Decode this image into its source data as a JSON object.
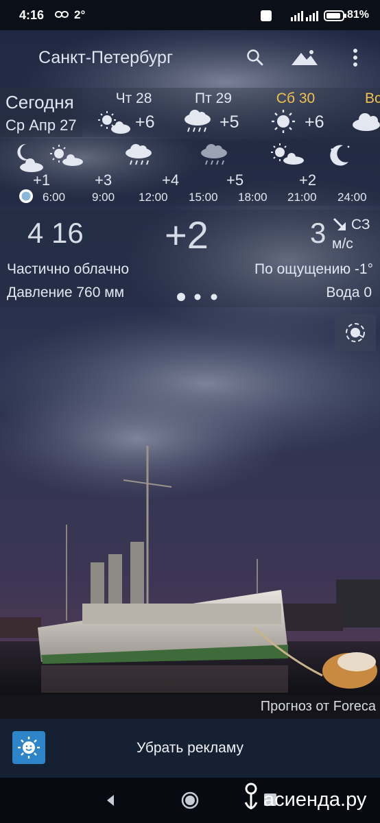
{
  "status_bar": {
    "time": "4:16",
    "notif_count": "2°",
    "battery": "81%"
  },
  "header": {
    "city": "Санкт-Петербург",
    "search_icon": "search-icon",
    "landscape_icon": "landscape-icon",
    "menu_icon": "more-vert-icon"
  },
  "today": {
    "label": "Сегодня",
    "date": "Ср Апр 27"
  },
  "days": [
    {
      "label": "Чт 28",
      "temp": "+6",
      "icon": "partly-cloudy-day"
    },
    {
      "label": "Пт 29",
      "temp": "+5",
      "icon": "rain"
    },
    {
      "label": "Сб 30",
      "temp": "+6",
      "icon": "sun",
      "accent": "#f2c14e"
    },
    {
      "label": "Вс",
      "temp": "",
      "icon": "cloud",
      "accent": "#f2c14e"
    }
  ],
  "hours": [
    {
      "time": "6:00",
      "temp": "+1",
      "icon": "moon-cloud"
    },
    {
      "time": "9:00",
      "temp": "+3",
      "icon": "sun-cloud"
    },
    {
      "time": "12:00",
      "temp": "+4",
      "icon": "rain"
    },
    {
      "time": "15:00",
      "temp": "+5",
      "icon": "rain-dim"
    },
    {
      "time": "18:00",
      "temp": "+2",
      "icon": "sun-cloud"
    },
    {
      "time": "21:00",
      "temp": "",
      "icon": "moon-stars"
    },
    {
      "time": "24:00",
      "temp": "",
      "icon": ""
    }
  ],
  "current": {
    "time": "4 16",
    "temp": "+2",
    "wind_speed": "3",
    "wind_dir": "СЗ",
    "wind_unit": "м/с",
    "condition": "Частично облачно",
    "feels_like": "По ощущению -1°",
    "pressure": "Давление 760 мм",
    "water": "Вода 0"
  },
  "credit": "Прогноз от Foreca",
  "ad": {
    "label": "Убрать рекламу"
  },
  "watermark": "асиенда.ру",
  "colors": {
    "accent": "#f2c14e",
    "ad_bar": "#152032",
    "sky_top": "#26314a",
    "sky_bottom": "#553a55"
  }
}
